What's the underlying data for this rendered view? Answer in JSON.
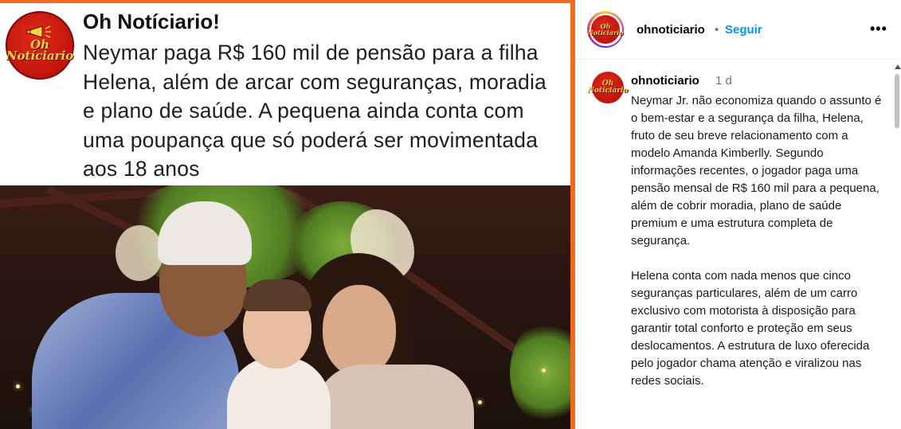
{
  "post_image": {
    "source_name": "Oh Notíciario!",
    "headline": "Neymar paga R$ 160 mil de pensão para a filha Helena, além de arcar com seguranças, moradia e plano de saúde. A pequena ainda conta com uma poupança que só poderá ser movimentada aos 18 anos",
    "logo_text_line1": "Oh",
    "logo_text_line2": "Notíciario",
    "accent_color": "#f26a1b",
    "photo_description_icon": "family-photo"
  },
  "sidebar": {
    "header": {
      "username": "ohnoticiario",
      "separator": "•",
      "follow_label": "Seguir",
      "more_label": "•••",
      "avatar_line1": "Oh",
      "avatar_line2": "Notíciario"
    },
    "caption": {
      "username": "ohnoticiario",
      "time": "1 d",
      "avatar_line1": "Oh",
      "avatar_line2": "Notíciario",
      "text": "Neymar Jr. não economiza quando o assunto é o bem-estar e a segurança da filha, Helena, fruto de seu breve relacionamento com a modelo Amanda Kimberlly. Segundo informações recentes, o jogador paga uma pensão mensal de R$ 160 mil para a pequena, além de cobrir moradia, plano de saúde premium e uma estrutura completa de segurança.\n\nHelena conta com nada menos que cinco seguranças particulares, além de um carro exclusivo com motorista à disposição para garantir total conforto e proteção em seus deslocamentos. A estrutura de luxo oferecida pelo jogador chama atenção e viralizou nas redes sociais."
    }
  },
  "colors": {
    "link_blue": "#0095f6",
    "muted_gray": "#737373",
    "brand_red": "#c1140c",
    "brand_yellow": "#ffd43b"
  }
}
